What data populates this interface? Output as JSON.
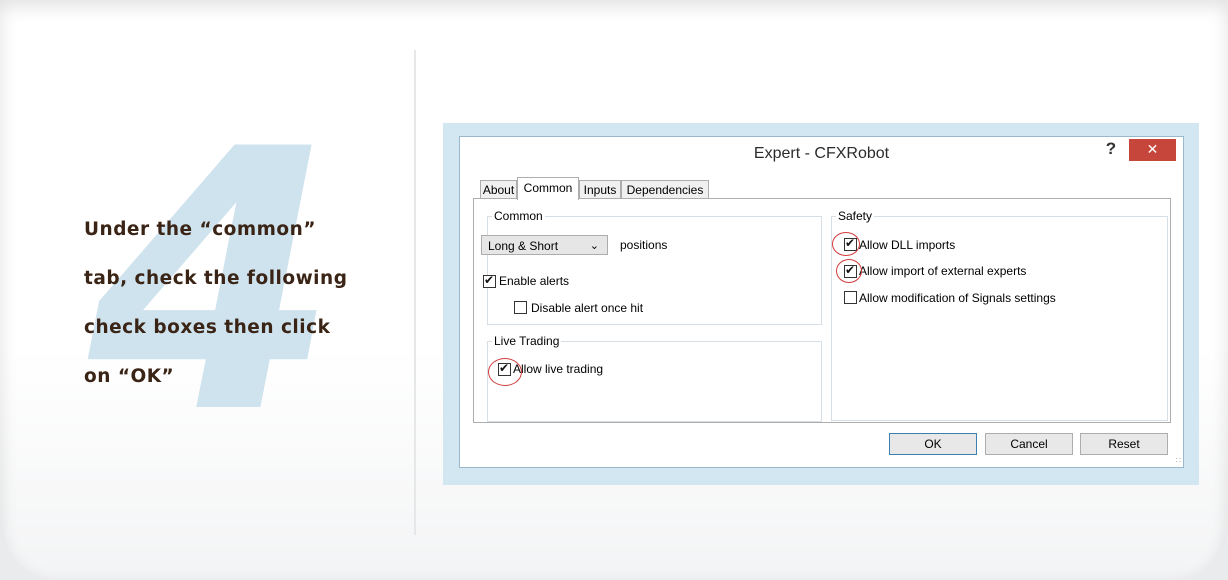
{
  "step": {
    "number": "4",
    "instruction": "Under the “common”\ntab, check the following\ncheck boxes then click\non “OK”"
  },
  "dialog": {
    "title": "Expert - CFXRobot",
    "help_label": "?",
    "close_label": "✕",
    "tabs": [
      {
        "label": "About",
        "active": false
      },
      {
        "label": "Common",
        "active": true
      },
      {
        "label": "Inputs",
        "active": false
      },
      {
        "label": "Dependencies",
        "active": false
      }
    ],
    "common": {
      "legend": "Common",
      "positions_select": "Long & Short",
      "positions_label": "positions",
      "enable_alerts": {
        "label": "Enable alerts",
        "checked": true
      },
      "disable_alert_once_hit": {
        "label": "Disable alert once hit",
        "checked": false
      }
    },
    "live_trading": {
      "legend": "Live Trading",
      "allow_live_trading": {
        "label": "Allow live trading",
        "checked": true
      }
    },
    "safety": {
      "legend": "Safety",
      "allow_dll_imports": {
        "label": "Allow DLL imports",
        "checked": true
      },
      "allow_import_external_experts": {
        "label": "Allow import of external experts",
        "checked": true
      },
      "allow_modification_signals": {
        "label": "Allow modification of Signals settings",
        "checked": false
      }
    },
    "buttons": {
      "ok": "OK",
      "cancel": "Cancel",
      "reset": "Reset"
    }
  },
  "colors": {
    "accent_number": "#cfe3ee",
    "instruction_text": "#3a2416",
    "close_button": "#c7463c",
    "annotation_circle": "#d23c3c"
  }
}
